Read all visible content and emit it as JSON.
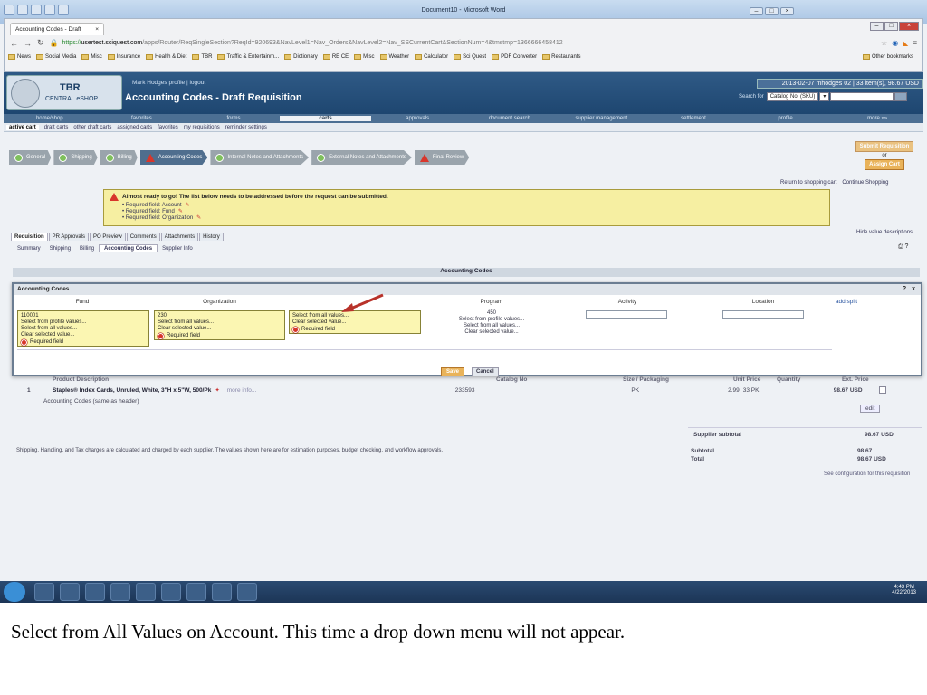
{
  "word": {
    "title": "Document10 - Microsoft Word"
  },
  "browser": {
    "tab_label": "Accounting Codes - Draft",
    "url_scheme": "https://",
    "url_host": "usertest.sciquest.com",
    "url_path": "/apps/Router/ReqSingleSection?ReqId=920693&NavLevel1=Nav_Orders&NavLevel2=Nav_SSCurrentCart&SectionNum=4&tmstmp=1366666458412",
    "bookmarks": [
      "News",
      "Social Media",
      "Misc",
      "Insurance",
      "Health & Diet",
      "TBR",
      "Traffic & Entertainm...",
      "Dictionary",
      "RE CE",
      "Misc",
      "Weather",
      "Calculator",
      "Sci Quest",
      "PDF Converter",
      "Restaurants"
    ],
    "other_bookmarks": "Other bookmarks"
  },
  "site": {
    "logo_title": "TBR",
    "logo_sub": "CENTRAL eSHOP",
    "user_line": "Mark Hodges   profile  |  logout",
    "page_title": "Accounting Codes - Draft Requisition",
    "date_cart": "2013-02-07 mhodges 02 | 33 item(s), 98.67 USD",
    "search_label": "Search for",
    "search_select": "Catalog No. (SKU)"
  },
  "main_nav": [
    "home/shop",
    "favorites",
    "forms",
    "carts",
    "approvals",
    "document search",
    "supplier management",
    "settlement",
    "profile",
    "more »»"
  ],
  "main_nav_active": "carts",
  "sub_nav": [
    "active cart",
    "draft carts",
    "other draft carts",
    "assigned carts",
    "favorites",
    "my requisitions",
    "reminder settings"
  ],
  "steps": [
    {
      "label": "General",
      "state": "ok"
    },
    {
      "label": "Shipping",
      "state": "ok"
    },
    {
      "label": "Billing",
      "state": "ok"
    },
    {
      "label": "Accounting Codes",
      "state": "warn"
    },
    {
      "label": "Internal Notes and Attachments",
      "state": "ok"
    },
    {
      "label": "External Notes and Attachments",
      "state": "ok"
    },
    {
      "label": "Final Review",
      "state": "warn"
    }
  ],
  "submit": {
    "submit_label": "Submit Requisition",
    "or_label": "or",
    "assign_label": "Assign Cart"
  },
  "return_links": [
    "Return to shopping cart",
    "Continue Shopping"
  ],
  "alert": {
    "heading": "Almost ready to go! The list below needs to be addressed before the request can be submitted.",
    "items": [
      "Required field: Account",
      "Required field: Fund",
      "Required field: Organization"
    ]
  },
  "req_tabs": [
    "Requisition",
    "PR Approvals",
    "PO Preview",
    "Comments",
    "Attachments",
    "History"
  ],
  "req_subtabs": [
    "Summary",
    "Shipping",
    "Billing",
    "Accounting Codes",
    "Supplier Info"
  ],
  "hide_desc": "Hide value descriptions",
  "section_title": "Accounting Codes",
  "modal": {
    "title": "Accounting Codes",
    "close": "x",
    "columns": [
      "Fund",
      "Organization",
      "Program",
      "Activity",
      "Location"
    ],
    "add_split": "add split",
    "fund": {
      "value": "110001",
      "opts": [
        "Select from profile values...",
        "Select from all values...",
        "Clear selected value..."
      ],
      "required": "Required field"
    },
    "organization": {
      "value": "230",
      "opts": [
        "Select from all values...",
        "Clear selected value..."
      ],
      "required": "Required field"
    },
    "account": {
      "opts": [
        "Select from all values...",
        "Clear selected value..."
      ],
      "required": "Required field"
    },
    "program": {
      "value": "450",
      "opts": [
        "Select from profile values...",
        "Select from all values...",
        "Clear selected value..."
      ]
    },
    "save": "Save",
    "cancel": "Cancel"
  },
  "table": {
    "headers": [
      "Product Description",
      "Catalog No",
      "Size / Packaging",
      "Unit Price",
      "Quantity",
      "Ext. Price"
    ],
    "row": {
      "num": "1",
      "desc": "Staples® Index Cards, Unruled, White, 3\"H x 5\"W, 500/Pk",
      "more": "more info...",
      "catalog": "233593",
      "size": "PK",
      "unit": "2.99",
      "qty": "33 PK",
      "ext": "98.67 USD"
    },
    "acct_same": "Accounting Codes (same as header)",
    "edit": "edit",
    "supplier_subtotal_label": "Supplier subtotal",
    "supplier_subtotal": "98.67 USD",
    "shipping_note": "Shipping, Handling, and Tax charges are calculated and charged by each supplier. The values shown here are for estimation purposes, budget checking, and workflow approvals.",
    "subtotal_label": "Subtotal",
    "subtotal": "98.67",
    "total_label": "Total",
    "total": "98.67 USD",
    "see_config": "See configuration for this requisition"
  },
  "taskbar": {
    "time": "4:43 PM",
    "date": "4/22/2013"
  },
  "caption": "Select from All Values on Account.  This time a drop down menu will not appear.",
  "colors": {
    "header_blue": "#1e4670",
    "alert_yellow": "#f6efa2",
    "field_yellow": "#fbf6b2",
    "arrow_red": "#c0392b",
    "button_orange": "#e9b35a"
  }
}
